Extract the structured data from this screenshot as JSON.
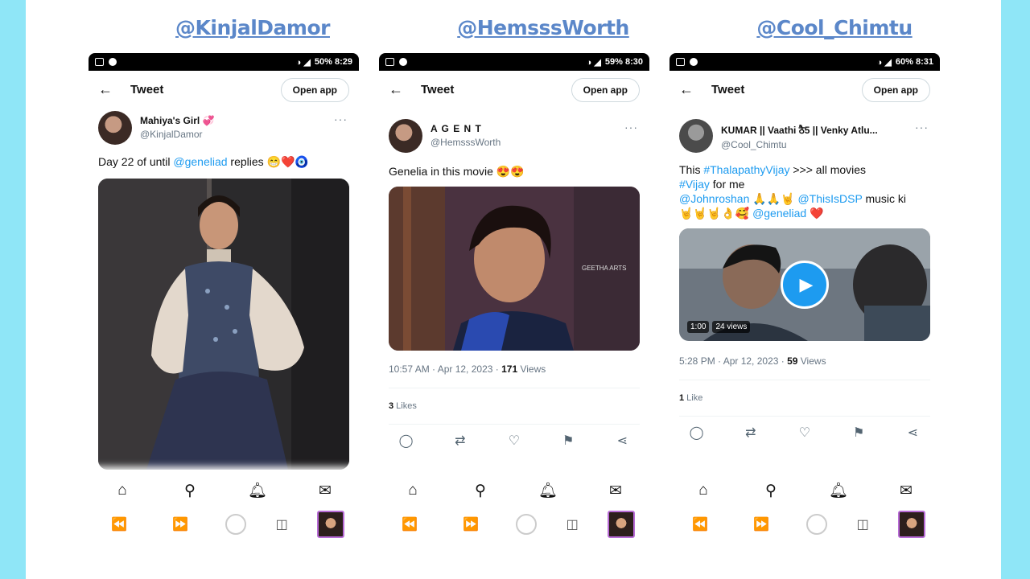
{
  "handles": [
    "@KinjalDamor",
    "@HemsssWorth",
    "@Cool_Chimtu"
  ],
  "phones": [
    {
      "status": {
        "right": "50% 8:29"
      },
      "topbar": {
        "title": "Tweet",
        "open_app": "Open app"
      },
      "author": {
        "display_name": "Mahiya's Girl 💞",
        "username": "@KinjalDamor"
      },
      "tweet_parts": [
        "Day 22 of until ",
        "@geneliad",
        " replies 😁❤️🧿"
      ]
    },
    {
      "status": {
        "right": "59% 8:30"
      },
      "topbar": {
        "title": "Tweet",
        "open_app": "Open app"
      },
      "author": {
        "display_name": "A G E N T",
        "username": "@HemsssWorth"
      },
      "tweet_parts": [
        "Genelia in this movie 😍😍"
      ],
      "watermark": "GEETHA ARTS",
      "meta": {
        "time": "10:57 AM · Apr 12, 2023 · ",
        "views_count": "171",
        "views_label": " Views"
      },
      "likes": {
        "count": "3",
        "label": " Likes"
      }
    },
    {
      "status": {
        "right": "60% 8:31"
      },
      "topbar": {
        "title": "Tweet",
        "open_app": "Open app"
      },
      "author": {
        "display_name": "KUMAR || Vaathi ठै5 || Venky Atlu...",
        "username": "@Cool_Chimtu"
      },
      "tweet_line1": [
        "This ",
        "#ThalapathyVijay",
        "  >>> all movies"
      ],
      "tweet_line2": [
        "#Vijay",
        " for me"
      ],
      "tweet_line3": [
        "@Johnroshan",
        " 🙏🙏🤘 ",
        "@ThisIsDSP",
        " music ki"
      ],
      "tweet_line4": [
        "🤘🤘🤘👌🥰 ",
        "@geneliad",
        " ❤️"
      ],
      "video": {
        "duration": "1:00",
        "views": "24 views"
      },
      "meta": {
        "time": "5:28 PM · Apr 12, 2023 · ",
        "views_count": "59",
        "views_label": " Views"
      },
      "likes": {
        "count": "1",
        "label": " Like"
      }
    }
  ],
  "colors": {
    "accent": "#1d9bf0",
    "handle": "#5b87c9",
    "background": "#8fe6f7"
  }
}
